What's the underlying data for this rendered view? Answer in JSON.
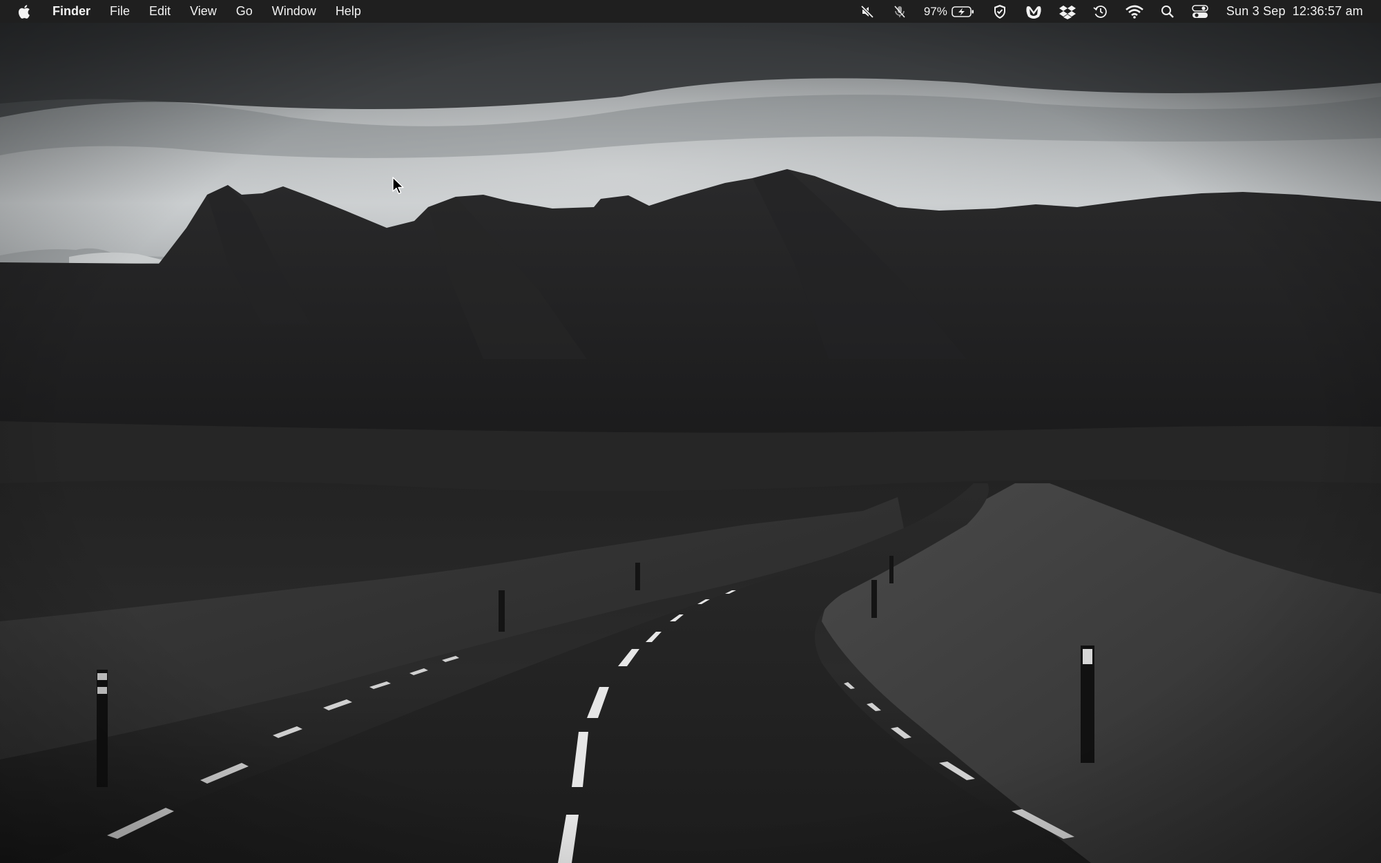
{
  "menubar": {
    "apple_icon": "apple-logo-icon",
    "app_name": "Finder",
    "menus": [
      "File",
      "Edit",
      "View",
      "Go",
      "Window",
      "Help"
    ],
    "status_icons": [
      "mute-icon",
      "mic-off-icon",
      "battery-charging-icon",
      "shield-check-icon",
      "malwarebytes-icon",
      "dropbox-icon",
      "time-machine-icon",
      "wifi-icon",
      "search-icon",
      "control-center-icon"
    ],
    "battery_percent": "97%",
    "date": "Sun 3 Sep",
    "time": "12:36:57 am"
  },
  "desktop": {
    "wallpaper": "monochrome-mountain-road",
    "colors": {
      "menubar_bg": "#1f1f1f",
      "menubar_text": "#f2f2f2"
    }
  }
}
